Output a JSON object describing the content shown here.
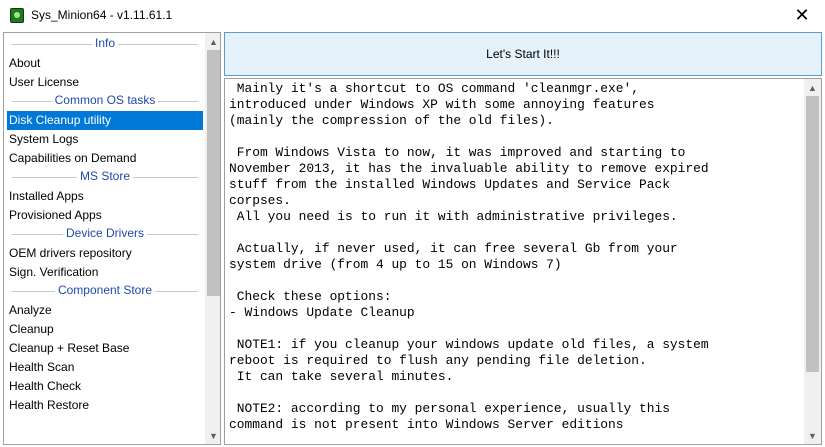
{
  "window": {
    "title": "Sys_Minion64 - v1.11.61.1",
    "close_glyph": "✕",
    "icon": "minion-app-icon"
  },
  "sidebar": {
    "rows": [
      {
        "type": "header",
        "label": "Info"
      },
      {
        "type": "item",
        "label": "About"
      },
      {
        "type": "item",
        "label": "User License"
      },
      {
        "type": "header",
        "label": "Common OS tasks"
      },
      {
        "type": "item",
        "label": "Disk Cleanup utility",
        "selected": true
      },
      {
        "type": "item",
        "label": "System Logs"
      },
      {
        "type": "item",
        "label": "Capabilities on Demand"
      },
      {
        "type": "header",
        "label": "MS Store"
      },
      {
        "type": "item",
        "label": "Installed Apps"
      },
      {
        "type": "item",
        "label": "Provisioned Apps"
      },
      {
        "type": "header",
        "label": "Device Drivers"
      },
      {
        "type": "item",
        "label": "OEM drivers repository"
      },
      {
        "type": "item",
        "label": "Sign. Verification"
      },
      {
        "type": "header",
        "label": "Component Store"
      },
      {
        "type": "item",
        "label": "Analyze"
      },
      {
        "type": "item",
        "label": "Cleanup"
      },
      {
        "type": "item",
        "label": "Cleanup + Reset Base"
      },
      {
        "type": "item",
        "label": "Health Scan"
      },
      {
        "type": "item",
        "label": "Health Check"
      },
      {
        "type": "item",
        "label": "Health Restore"
      }
    ],
    "scroll": {
      "up_glyph": "▲",
      "down_glyph": "▼"
    }
  },
  "main": {
    "start_button_label": "Let's Start It!!!",
    "description": " Mainly it's a shortcut to OS command 'cleanmgr.exe',\nintroduced under Windows XP with some annoying features\n(mainly the compression of the old files).\n\n From Windows Vista to now, it was improved and starting to\nNovember 2013, it has the invaluable ability to remove expired\nstuff from the installed Windows Updates and Service Pack\ncorpses.\n All you need is to run it with administrative privileges.\n\n Actually, if never used, it can free several Gb from your\nsystem drive (from 4 up to 15 on Windows 7)\n\n Check these options:\n- Windows Update Cleanup\n\n NOTE1: if you cleanup your windows update old files, a system\nreboot is required to flush any pending file deletion.\n It can take several minutes.\n\n NOTE2: according to my personal experience, usually this\ncommand is not present into Windows Server editions",
    "scroll": {
      "up_glyph": "▲",
      "down_glyph": "▼"
    }
  }
}
